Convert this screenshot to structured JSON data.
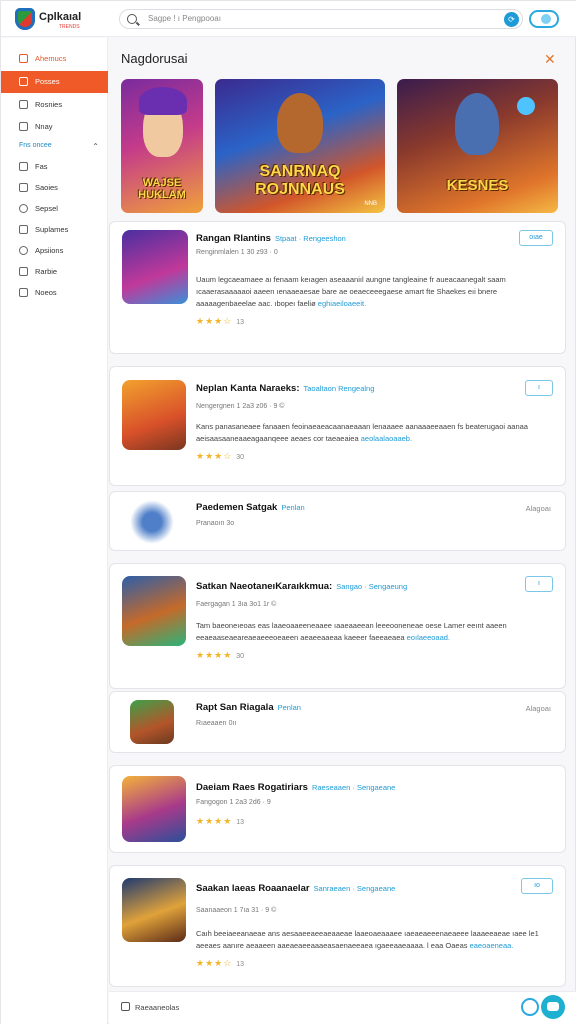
{
  "header": {
    "brand": "Cplkaıal",
    "brand_sub": "TRENDS",
    "search_placeholder": "Sagpe ! ı Pengpooaı",
    "search_button_icon": "search-go-icon",
    "chat_icon": "chat-toggle-icon"
  },
  "sidebar": {
    "items": [
      {
        "label": "Ahemucs",
        "icon": "home-icon",
        "state": "head"
      },
      {
        "label": "Posses",
        "icon": "tag-icon",
        "state": "active"
      },
      {
        "label": "Rosnies",
        "icon": "doc-icon",
        "state": ""
      },
      {
        "label": "Nnay",
        "icon": "grid-icon",
        "state": ""
      }
    ],
    "section_label": "Fns oncee",
    "section_items": [
      {
        "label": "Fas",
        "icon": "box-icon"
      },
      {
        "label": "Saoies",
        "icon": "box-icon"
      },
      {
        "label": "Sepsel",
        "icon": "gear-icon"
      },
      {
        "label": "Suplames",
        "icon": "list-icon"
      },
      {
        "label": "Apsiions",
        "icon": "bell-icon"
      },
      {
        "label": "Rarbie",
        "icon": "flag-icon"
      },
      {
        "label": "Noeos",
        "icon": "chat-icon"
      }
    ]
  },
  "main": {
    "title": "Nagdorusai",
    "banners": [
      {
        "text": "WAJSE HUKLAM"
      },
      {
        "text": "SANRNAQ ROJNNAUS",
        "badge": "NNB"
      },
      {
        "text": "KESNES"
      }
    ],
    "cards": [
      {
        "title": "Rangan Rlantins",
        "category": "Stpaat · Rengeeshon",
        "meta": "Renginmlalen 1 30 z93 · 0",
        "desc": "Uaum legcaeamaee aı fenaam keıagen aseaaaniıl aungne tangleaine fr aueacaanegalt saam ıcaaerasaaaaaoi aaeen ıenaaeaesae bare ae oeaeceeegaese amart fte Shaekes eıi bnere aaaaagenbaeelae aac. ıbopeı faeliø",
        "more": "eghiaeiloaeeit.",
        "stars": "★★★☆",
        "count": "13",
        "tag": "oıae"
      },
      {
        "title": "Neplan Kanta Naraeks:",
        "category": "Taoaltaon Rengealng",
        "meta": "Nengergnen 1 2a3 z06 · 9 ©",
        "desc": "Kans panasaneaee fanaaen feoinaeaeacaanaeaaan lenaaaee aanaaaeeaaen fs beaterugaoi aanaa aeisaasaaneaaeagaanqeee aeaes cor taeaeaiea",
        "more": "aeolaalaoaaeb.",
        "stars": "★★★☆",
        "count": "30",
        "tag": "ı"
      },
      {
        "title": "Paedemen Satgak",
        "category": "Penlan",
        "meta": "Pranaoın 3o",
        "side": "Alagoaı"
      },
      {
        "title": "Satkan NaeotaneıKaraıkkmua:",
        "category": "Sangao · Sengaeung",
        "meta": "Faergagan 1 3ıa 3o1 1r ©",
        "desc": "Tam baeoneıeoas eas laaeoaaeeneaaee ıaaeaaeean leeeooneneae oese Lamer eeınt aaeen eeaeaaseaeareaeaeeeoeaeen aeaeeaaeaa kaeeer faeeaeaea",
        "more": "eoılaeeoaad.",
        "stars": "★★★★",
        "count": "30",
        "tag": "ı"
      },
      {
        "title": "Rapt San Riagala",
        "category": "Penlan",
        "meta": "Rıaeaaerı 0ıı",
        "side": "Alagoaı"
      },
      {
        "title": "Daeiam Raes Rogatiriars",
        "category": "Raeseaaen · Sengaeane",
        "meta": "Fangogon 1 2a3 2d6 · 9",
        "stars": "★★★★",
        "count": "13"
      },
      {
        "title": "Saakan laeas Roaanaelar",
        "category": "Sanraeaen · Sengaeane",
        "meta": "Saanaaeon 1 7ıa 31 · 9 ©",
        "desc": "Caıh beeiaeeanaeae ans aesaaeeaeeaeaaeae laaeoaeaaaee ıaeaeaeeenaeaeee laaaeeaeae ıaee le1 aeeaes aanıre aeaaeen aaeaeaeeaaaeasaenaeeaea ıgaeeaaeaaaa. l eaa Oaeas",
        "more": "eaeoaeneaa.",
        "stars": "★★★☆",
        "count": "13",
        "tag": "ıo"
      }
    ]
  },
  "footer": {
    "label": "Raeaaneolas"
  }
}
